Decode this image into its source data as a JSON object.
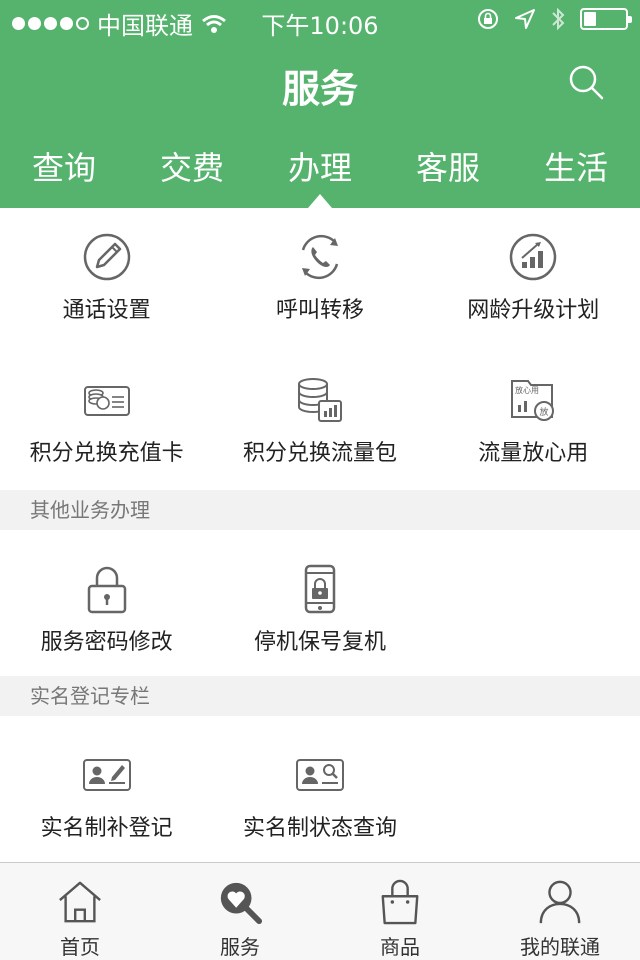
{
  "status": {
    "carrier": "中国联通",
    "time": "下午10:06"
  },
  "header": {
    "title": "服务"
  },
  "tabs": [
    {
      "label": "查询"
    },
    {
      "label": "交费"
    },
    {
      "label": "办理"
    },
    {
      "label": "客服"
    },
    {
      "label": "生活"
    }
  ],
  "main_grid": [
    {
      "label": "通话设置",
      "icon": "pencil-icon"
    },
    {
      "label": "呼叫转移",
      "icon": "phone-transfer-icon"
    },
    {
      "label": "网龄升级计划",
      "icon": "signal-upgrade-icon"
    },
    {
      "label": "积分兑换充值卡",
      "icon": "points-card-icon"
    },
    {
      "label": "积分兑换流量包",
      "icon": "data-package-icon"
    },
    {
      "label": "流量放心用",
      "icon": "worry-free-data-icon",
      "badge": "放心用",
      "badge2": "放"
    }
  ],
  "other_section": {
    "header": "其他业务办理",
    "items": [
      {
        "label": "服务密码修改",
        "icon": "lock-icon"
      },
      {
        "label": "停机保号复机",
        "icon": "phone-lock-icon"
      }
    ]
  },
  "realname_section": {
    "header": "实名登记专栏",
    "items": [
      {
        "label": "实名制补登记",
        "icon": "id-card-edit-icon"
      },
      {
        "label": "实名制状态查询",
        "icon": "id-card-search-icon"
      }
    ]
  },
  "bottom_nav": [
    {
      "label": "首页",
      "icon": "home-icon"
    },
    {
      "label": "服务",
      "icon": "service-search-icon"
    },
    {
      "label": "商品",
      "icon": "shopping-bag-icon"
    },
    {
      "label": "我的联通",
      "icon": "user-icon"
    }
  ],
  "colors": {
    "brand": "#56b36e",
    "icon_gray": "#666666"
  }
}
